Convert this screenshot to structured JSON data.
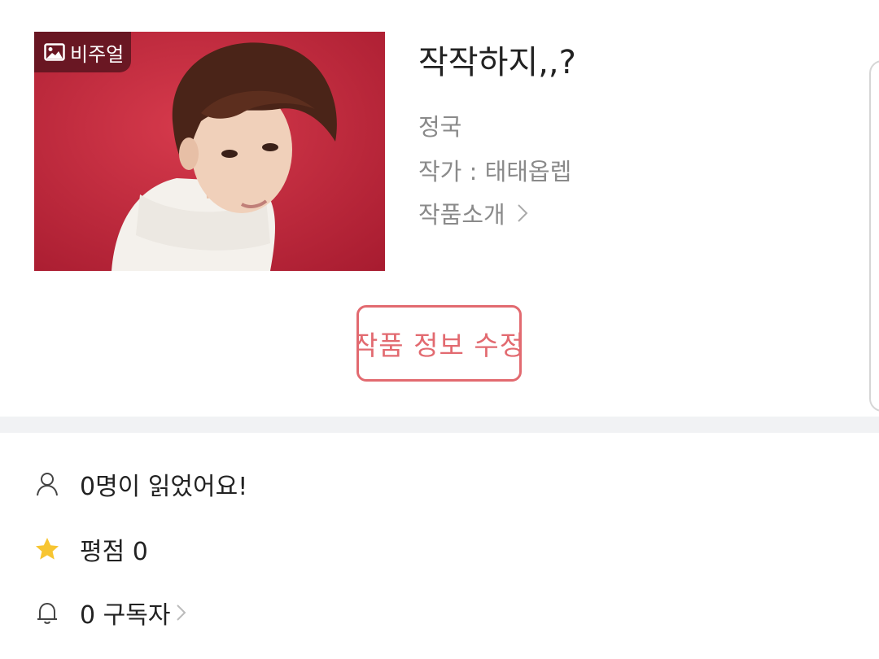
{
  "work": {
    "badge_label": "비주얼",
    "title": "작작하지,,?",
    "character": "정국",
    "author": "작가 : 태태옵렙",
    "intro_link": "작품소개",
    "edit_button": "작품 정보 수정"
  },
  "stats": {
    "readers": "0명이 읽었어요!",
    "rating": "평점 0",
    "subscribers": "0 구독자"
  },
  "colors": {
    "accent": "#e26a70",
    "cover_background": "#c8283c",
    "star": "#f7c531",
    "divider": "#f1f2f4"
  },
  "icons": {
    "badge": "image-icon",
    "readers": "person-icon",
    "rating": "star-icon",
    "subscribers": "bell-icon",
    "chevron": "chevron-right-icon"
  }
}
